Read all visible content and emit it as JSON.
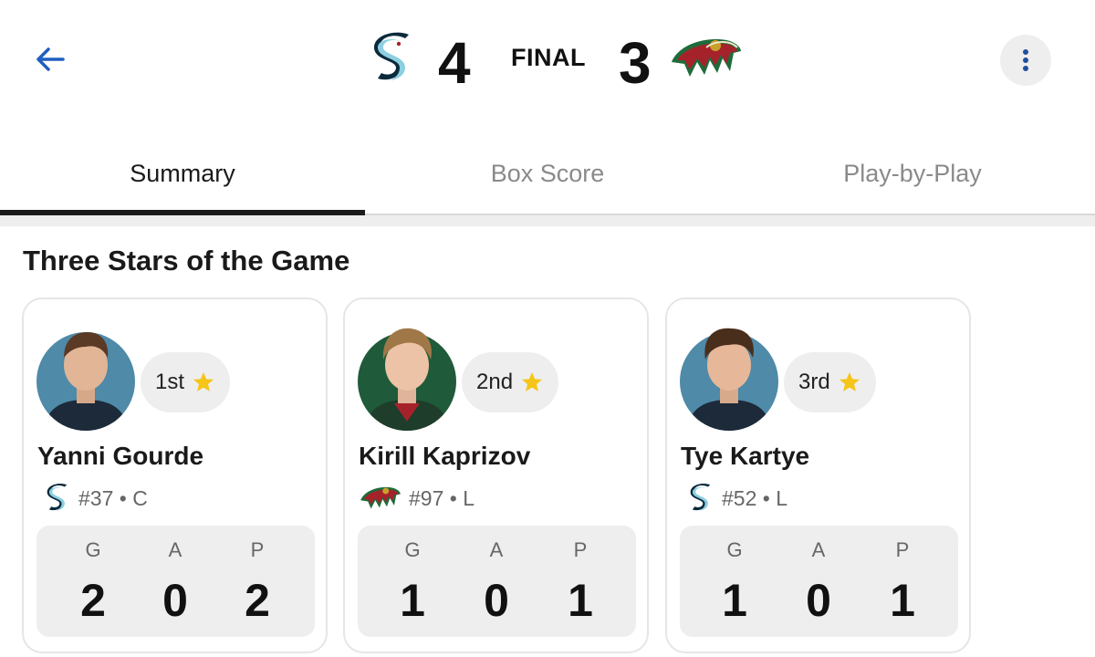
{
  "header": {
    "home_team": "Seattle Kraken",
    "home_score": "4",
    "status": "FINAL",
    "away_team": "Minnesota Wild",
    "away_score": "3"
  },
  "tabs": [
    {
      "label": "Summary",
      "active": true
    },
    {
      "label": "Box Score",
      "active": false
    },
    {
      "label": "Play-by-Play",
      "active": false
    }
  ],
  "section_title": "Three Stars of the Game",
  "stars": [
    {
      "rank": "1st",
      "name": "Yanni Gourde",
      "team": "SEA",
      "meta": "#37 • C",
      "stats": [
        {
          "label": "G",
          "value": "2"
        },
        {
          "label": "A",
          "value": "0"
        },
        {
          "label": "P",
          "value": "2"
        }
      ]
    },
    {
      "rank": "2nd",
      "name": "Kirill Kaprizov",
      "team": "MIN",
      "meta": "#97 • L",
      "stats": [
        {
          "label": "G",
          "value": "1"
        },
        {
          "label": "A",
          "value": "0"
        },
        {
          "label": "P",
          "value": "1"
        }
      ]
    },
    {
      "rank": "3rd",
      "name": "Tye Kartye",
      "team": "SEA",
      "meta": "#52 • L",
      "stats": [
        {
          "label": "G",
          "value": "1"
        },
        {
          "label": "A",
          "value": "0"
        },
        {
          "label": "P",
          "value": "1"
        }
      ]
    }
  ],
  "icons": {
    "back": "arrow-left-icon",
    "more": "more-vertical-icon",
    "star": "star-icon"
  },
  "colors": {
    "back_arrow": "#1f5fbf",
    "star": "#f5c518",
    "kraken_light": "#8ccfe0",
    "kraken_dark": "#0b2a3c",
    "wild_green": "#1f6b3a",
    "wild_red": "#a5222b",
    "wild_gold": "#c9a02b"
  }
}
